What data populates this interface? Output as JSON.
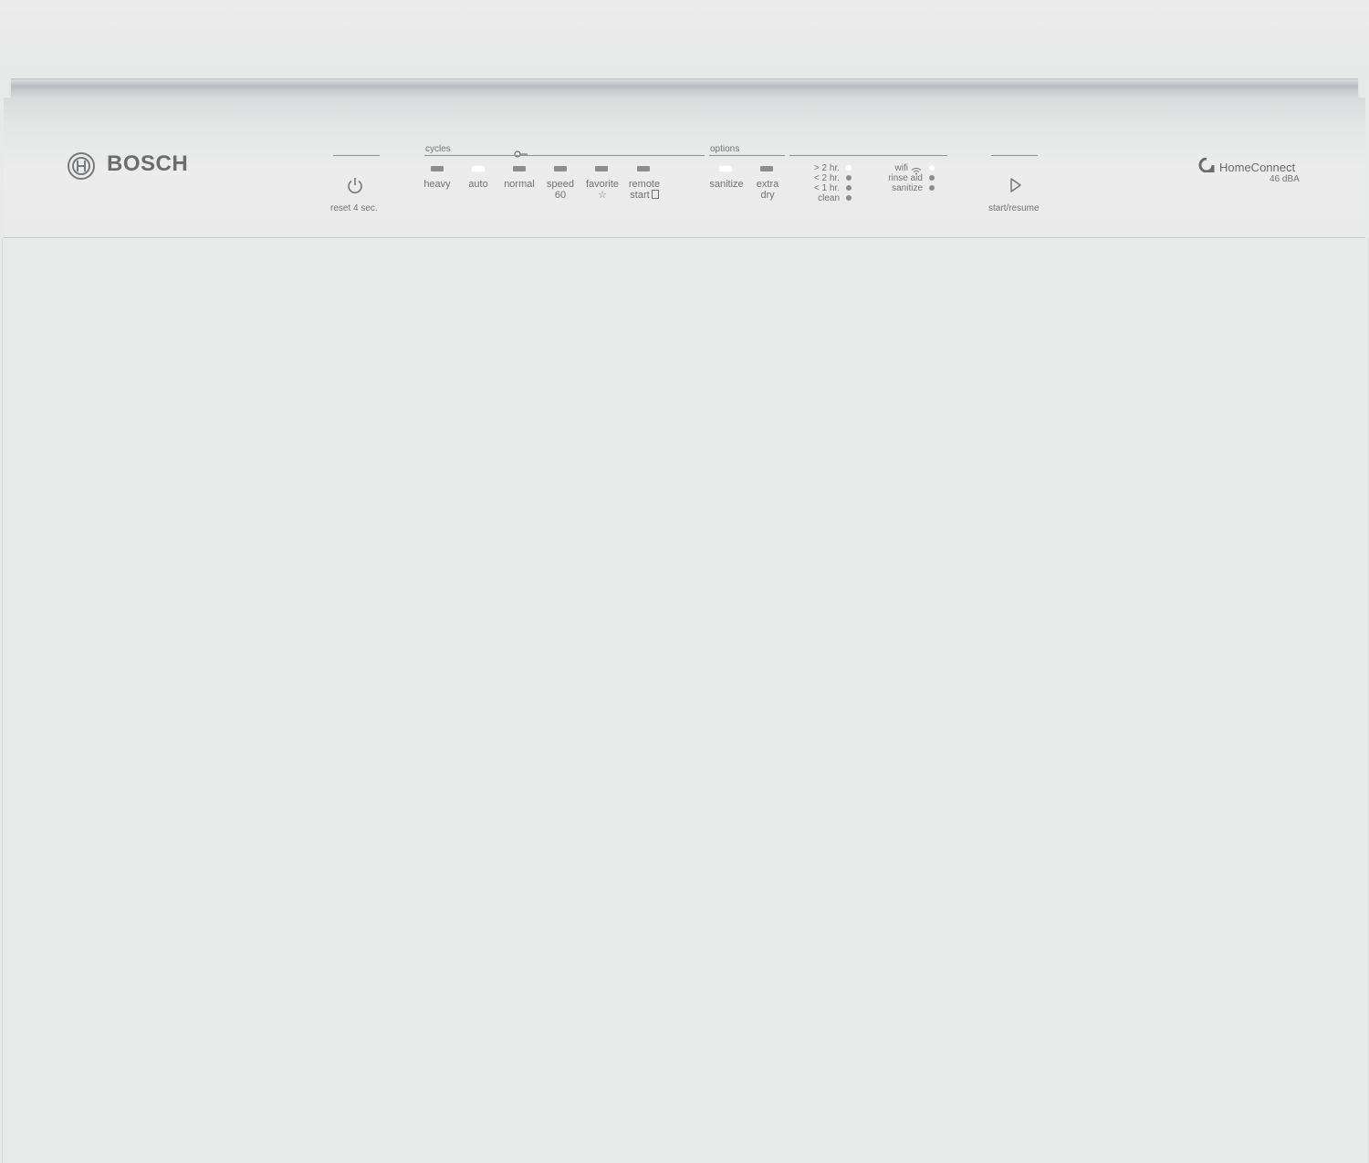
{
  "brand": {
    "name": "BOSCH",
    "logo_icon": "bosch-emblem-icon"
  },
  "power": {
    "label": "reset 4 sec.",
    "icon": "power-icon"
  },
  "cycles": {
    "header": "cycles",
    "child_lock_icon": "key-icon",
    "items": [
      {
        "line1": "heavy",
        "line2": "",
        "lit": false
      },
      {
        "line1": "auto",
        "line2": "",
        "lit": true
      },
      {
        "line1": "normal",
        "line2": "",
        "lit": false
      },
      {
        "line1": "speed",
        "line2": "60",
        "lit": false
      },
      {
        "line1": "favorite",
        "line2": "☆",
        "lit": false
      },
      {
        "line1": "remote",
        "line2": "start",
        "lit": false
      }
    ]
  },
  "options": {
    "header": "options",
    "items": [
      {
        "line1": "sanitize",
        "line2": "",
        "lit": true
      },
      {
        "line1": "extra",
        "line2": "dry",
        "lit": false
      }
    ]
  },
  "time_status": [
    {
      "label": "> 2 hr.",
      "lit": true
    },
    {
      "label": "< 2 hr.",
      "lit": false
    },
    {
      "label": "< 1 hr.",
      "lit": false
    },
    {
      "label": "clean",
      "lit": false
    }
  ],
  "device_status": [
    {
      "label": "wifi",
      "lit": true,
      "icon": "wifi-icon"
    },
    {
      "label": "rinse aid",
      "lit": false
    },
    {
      "label": "sanitize",
      "lit": false
    }
  ],
  "start": {
    "label": "start/resume",
    "icon": "play-icon"
  },
  "home_connect": {
    "label": "HomeConnect",
    "noise": "46 dBA",
    "icon": "home-connect-icon"
  }
}
